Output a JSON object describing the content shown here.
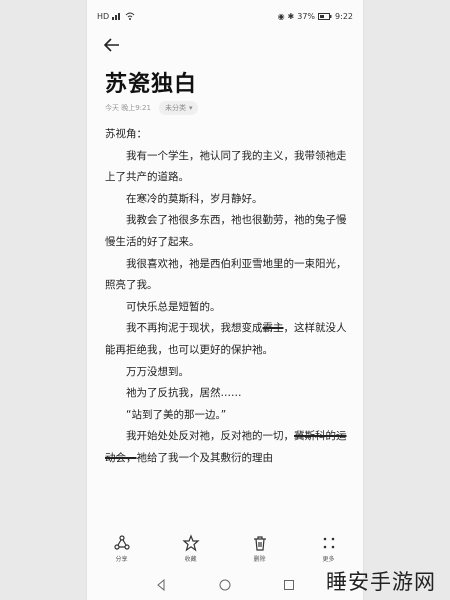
{
  "status_bar": {
    "signal": "HD",
    "battery": "37%",
    "time": "9:22"
  },
  "note": {
    "title": "苏瓷独白",
    "timestamp": "今天 晚上9:21",
    "category": "未分类",
    "paragraphs": [
      "苏视角：",
      "我有一个学生，祂认同了我的主义，我带领祂走上了共产的道路。",
      "在寒冷的莫斯科，岁月静好。",
      "我教会了祂很多东西，祂也很勤劳，祂的兔子慢慢生活的好了起来。",
      "我很喜欢祂，祂是西伯利亚雪地里的一束阳光，照亮了我。",
      "可快乐总是短暂的。",
      "万万没想到。",
      "祂为了反抗我，居然……",
      "“站到了美的那一边。”"
    ],
    "p_change_before": "我不再拘泥于现状，我想变成",
    "p_change_struck": "霸主",
    "p_change_after": "，这样就没人能再拒绝我，也可以更好的保护祂。",
    "p_last_before": "我开始处处反对祂，反对祂的一切，",
    "p_last_struck": "冀斯科的运动会，",
    "p_last_after": "祂给了我一个及其敷衍的理由"
  },
  "toolbar": {
    "share": "分享",
    "favorite": "收藏",
    "delete": "删除",
    "more": "更多"
  },
  "watermark": "睡安手游网"
}
